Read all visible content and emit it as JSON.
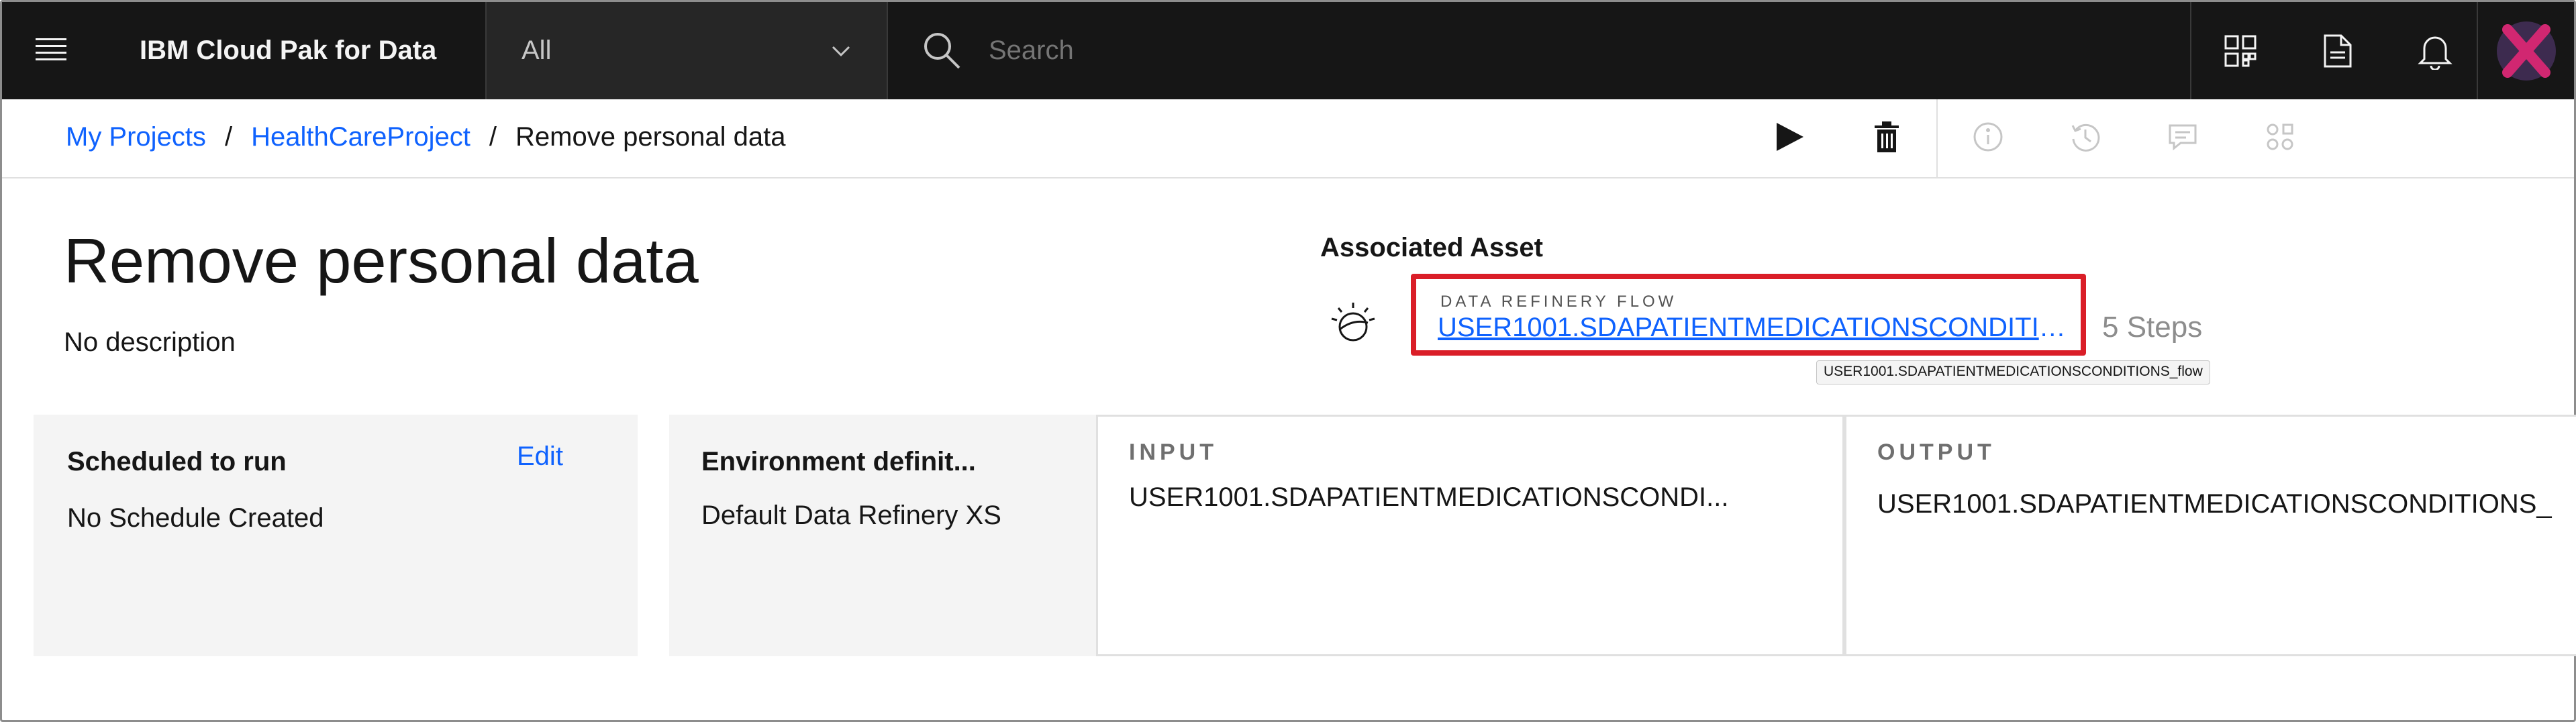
{
  "header": {
    "brand": "IBM Cloud Pak for Data",
    "scope_value": "All",
    "search_placeholder": "Search"
  },
  "icons": {
    "menu": "hamburger-icon",
    "chevron": "chevron-down-icon",
    "search": "search-icon",
    "topbar": [
      "apps-grid-icon",
      "document-icon",
      "notification-bell-icon"
    ],
    "avatar": "user-avatar-icon",
    "toolbar": [
      "play-icon",
      "trash-icon",
      "info-icon",
      "history-icon",
      "chat-icon",
      "grid-settings-icon"
    ],
    "asset": "data-refinery-icon"
  },
  "breadcrumb": {
    "items": [
      "My Projects",
      "HealthCareProject"
    ],
    "current": "Remove personal data",
    "separator": "/"
  },
  "page": {
    "title": "Remove personal data",
    "description": "No description"
  },
  "associated_asset": {
    "heading": "Associated Asset",
    "type_label": "DATA REFINERY FLOW",
    "link": "USER1001.SDAPATIENTMEDICATIONSCONDITIONS_flow",
    "steps": "5 Steps",
    "tooltip": "USER1001.SDAPATIENTMEDICATIONSCONDITIONS_flow"
  },
  "cards": {
    "schedule": {
      "title": "Scheduled to run",
      "edit": "Edit",
      "value": "No Schedule Created"
    },
    "environment": {
      "title": "Environment definit...",
      "value": "Default Data Refinery XS"
    },
    "input": {
      "label": "INPUT",
      "value": "USER1001.SDAPATIENTMEDICATIONSCONDI..."
    },
    "output": {
      "label": "OUTPUT",
      "value": "USER1001.SDAPATIENTMEDICATIONSCONDITIONS_"
    }
  },
  "colors": {
    "header_bg": "#161616",
    "link": "#0f62fe",
    "highlight": "#da1e28",
    "card_bg": "#f4f4f4",
    "avatar_accent": "#d12771"
  }
}
